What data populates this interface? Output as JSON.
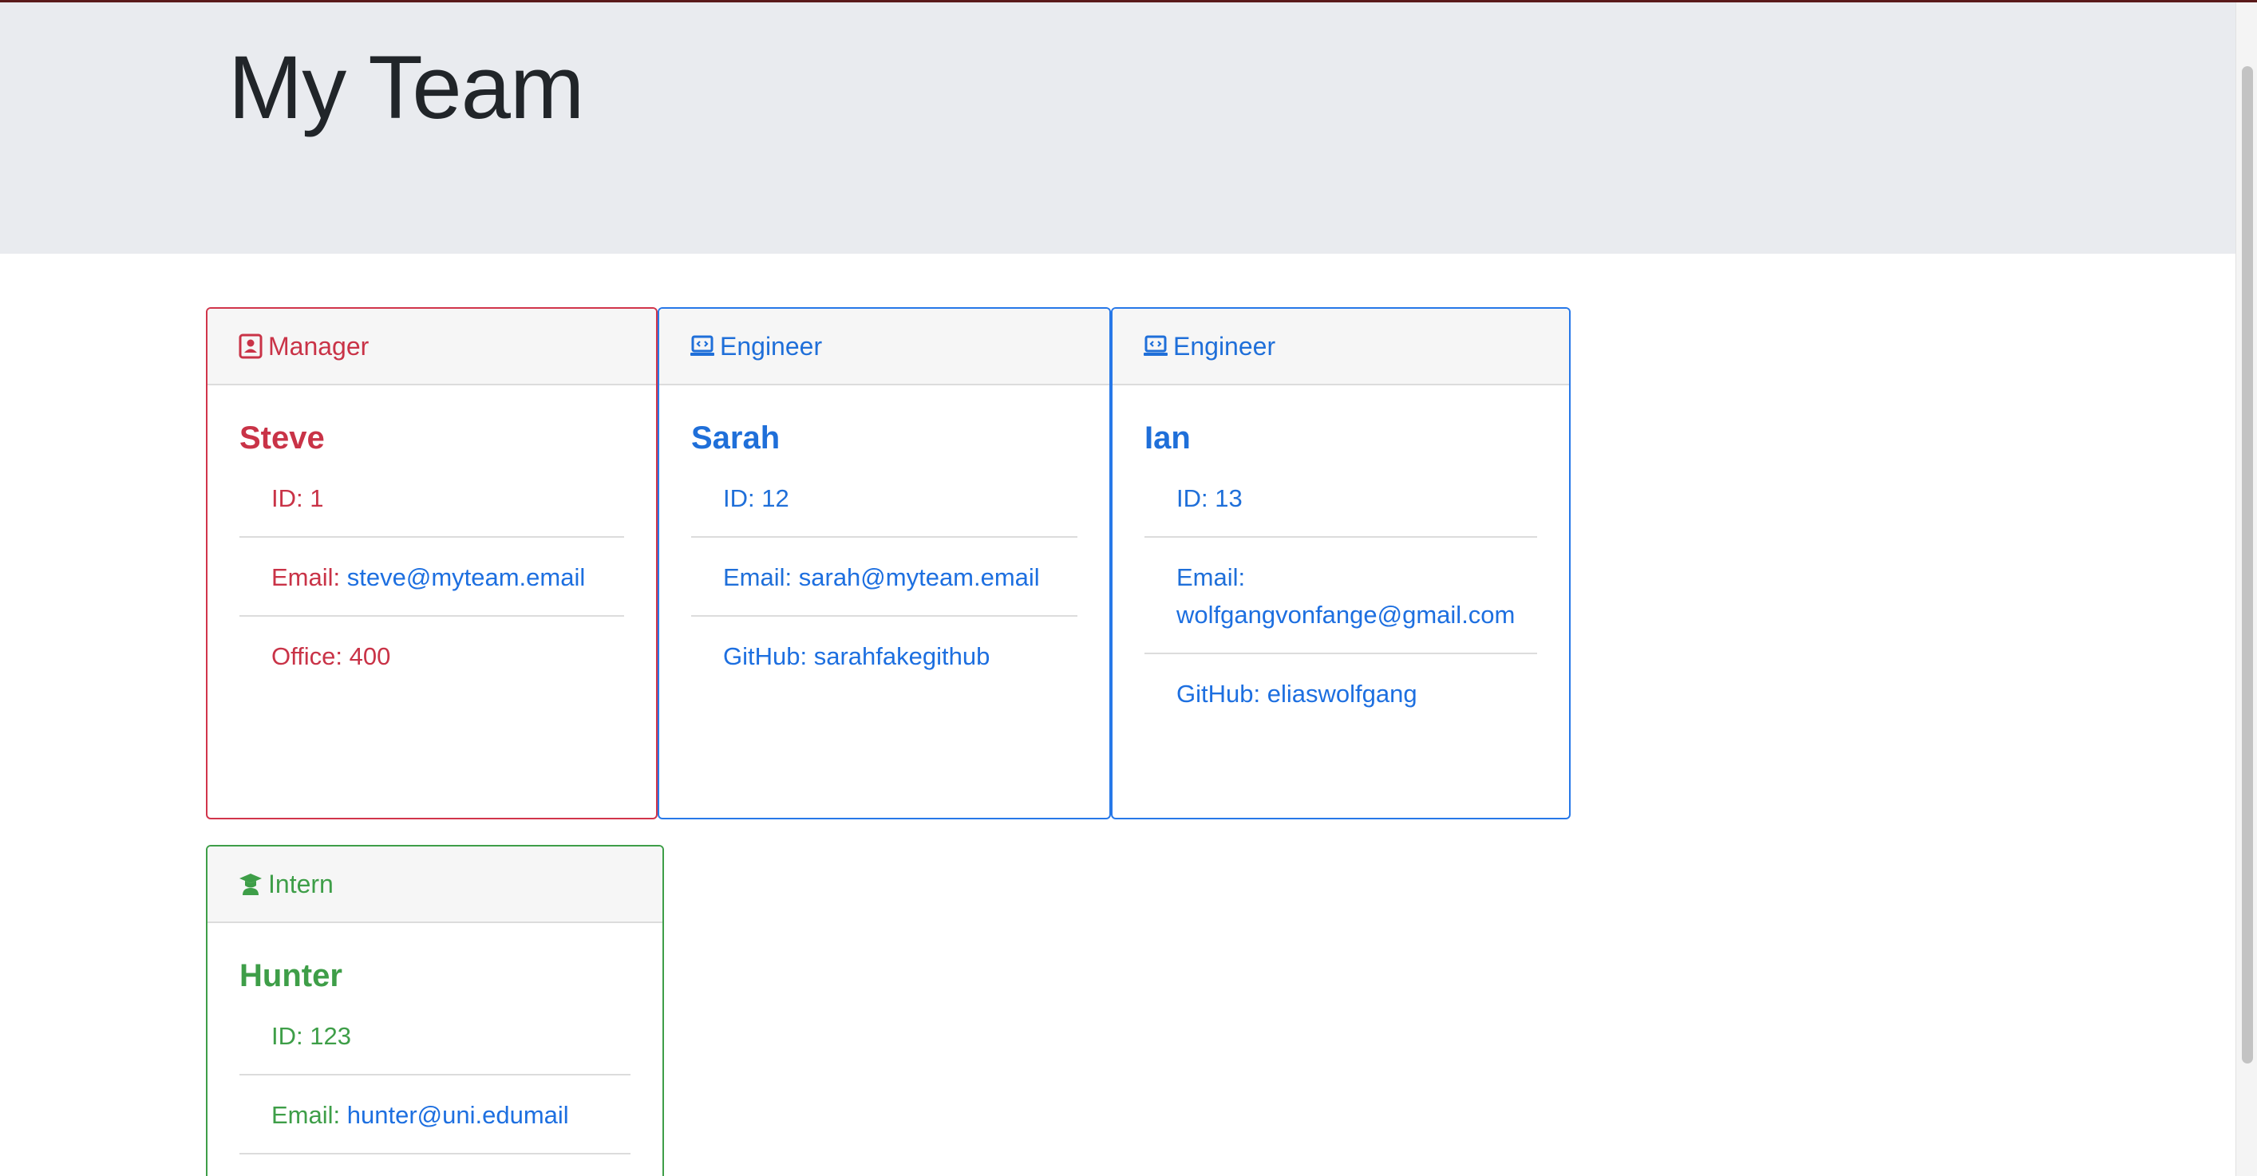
{
  "header": {
    "title": "My Team"
  },
  "cards": [
    {
      "role": "Manager",
      "icon": "id-badge-icon",
      "name": "Steve",
      "id_label": "ID: 1",
      "email_label": "Email: ",
      "email": "steve@myteam.email",
      "extra_label": "Office: 400",
      "color": "#c93347"
    },
    {
      "role": "Engineer",
      "icon": "laptop-code-icon",
      "name": "Sarah",
      "id_label": "ID: 12",
      "email_label": "Email: ",
      "email": "sarah@myteam.email",
      "extra_label": "GitHub: sarahfakegithub",
      "color": "#1f6fd9"
    },
    {
      "role": "Engineer",
      "icon": "laptop-code-icon",
      "name": "Ian",
      "id_label": "ID: 13",
      "email_label": "Email: ",
      "email": "wolfgangvonfange@gmail.com",
      "extra_label": "GitHub: eliaswolfgang",
      "color": "#1f6fd9"
    },
    {
      "role": "Intern",
      "icon": "graduate-icon",
      "name": "Hunter",
      "id_label": "ID: 123",
      "email_label": "Email: ",
      "email": "hunter@uni.edumail",
      "color": "#3e9e48"
    }
  ]
}
